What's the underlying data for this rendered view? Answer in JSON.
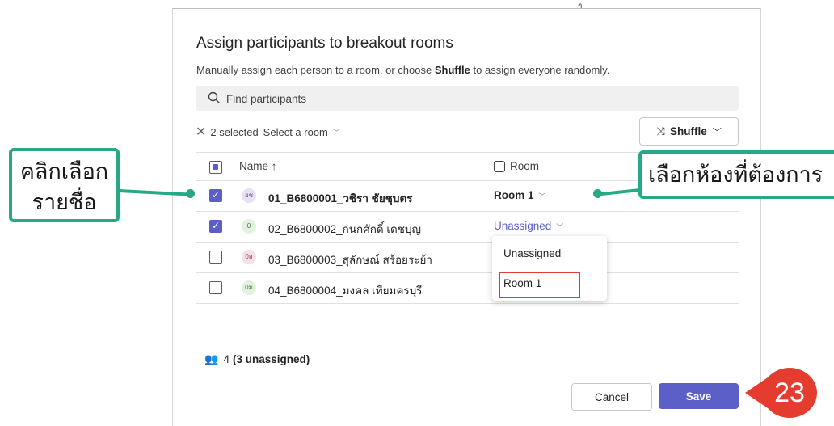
{
  "dialog": {
    "title": "Assign participants to breakout rooms",
    "subtitle_pre": "Manually assign each person to a room, or choose ",
    "subtitle_bold": "Shuffle",
    "subtitle_post": " to assign everyone randomly.",
    "search_placeholder": "Find participants",
    "selection_text": "2 selected",
    "select_room_label": "Select a room",
    "shuffle_label": "Shuffle",
    "columns": {
      "name": "Name ↑",
      "room": "Room"
    },
    "participants": [
      {
        "initials": "อช",
        "name": "01_B6800001_วชิรา ชัยชุบตร",
        "room": "Room 1",
        "checked": true
      },
      {
        "initials": "0",
        "name": "02_B6800002_กนกศักดิ์ เดชบุญ",
        "room": "Unassigned",
        "checked": true
      },
      {
        "initials": "0ส",
        "name": "03_B6800003_สุลักษณ์ สร้อยระย้า",
        "room": "",
        "checked": false
      },
      {
        "initials": "0ม",
        "name": "04_B6800004_มงคล เทียมครบุรี",
        "room": "",
        "checked": false
      }
    ],
    "dropdown_options": [
      "Unassigned",
      "Room 1"
    ],
    "count_number": "4",
    "count_detail": "(3 unassigned)",
    "cancel_label": "Cancel",
    "save_label": "Save"
  },
  "annotations": {
    "callout_left_line1": "คลิกเลือก",
    "callout_left_line2": "รายชื่อ",
    "callout_right": "เลือกห้องที่ต้องการ",
    "step_number": "23",
    "top_mark": "ๆ"
  },
  "colors": {
    "accent": "#5b5fc7",
    "callout": "#26a984",
    "badge": "#e43d30",
    "highlight": "#e03a3a"
  }
}
